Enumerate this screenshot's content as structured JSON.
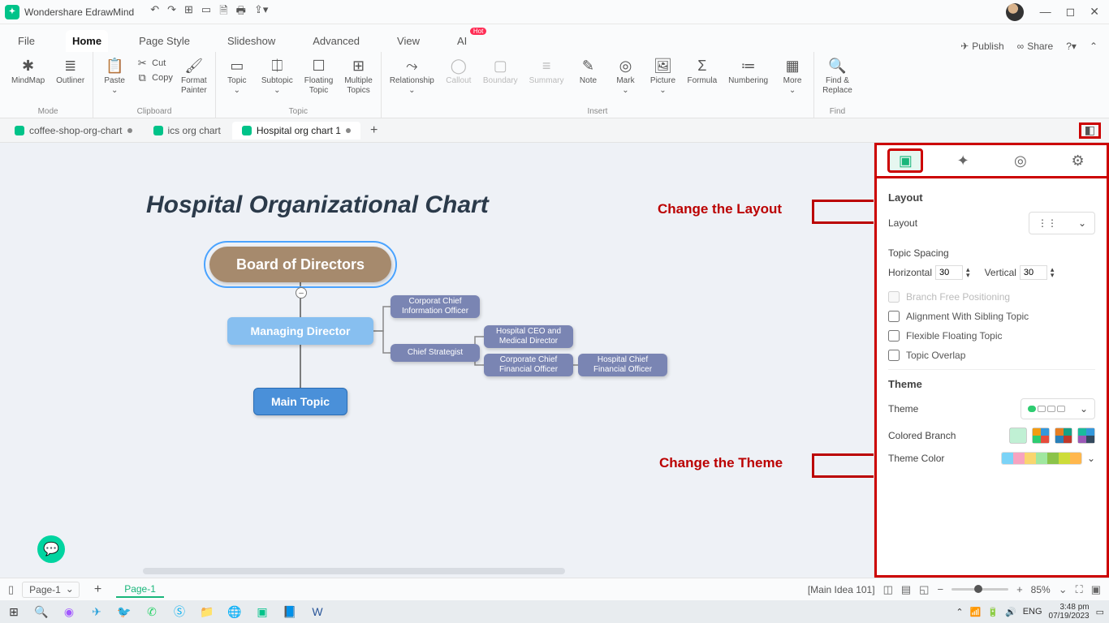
{
  "app": {
    "title": "Wondershare EdrawMind"
  },
  "menus": {
    "items": [
      "File",
      "Home",
      "Page Style",
      "Slideshow",
      "Advanced",
      "View",
      "AI"
    ],
    "active": "Home",
    "publish": "Publish",
    "share": "Share"
  },
  "ribbon": {
    "mode": {
      "label": "Mode",
      "mindmap": "MindMap",
      "outliner": "Outliner"
    },
    "clipboard": {
      "label": "Clipboard",
      "paste": "Paste",
      "cut": "Cut",
      "copy": "Copy",
      "format_painter": "Format\nPainter"
    },
    "topic": {
      "label": "Topic",
      "topic": "Topic",
      "subtopic": "Subtopic",
      "floating": "Floating\nTopic",
      "multiple": "Multiple\nTopics"
    },
    "insert": {
      "label": "Insert",
      "relationship": "Relationship",
      "callout": "Callout",
      "boundary": "Boundary",
      "summary": "Summary",
      "note": "Note",
      "mark": "Mark",
      "picture": "Picture",
      "formula": "Formula",
      "numbering": "Numbering",
      "more": "More"
    },
    "find": {
      "label": "Find",
      "find_replace": "Find &\nReplace"
    }
  },
  "tabs": {
    "items": [
      {
        "name": "coffee-shop-org-chart",
        "dirty": true
      },
      {
        "name": "ics org chart",
        "dirty": false
      },
      {
        "name": "Hospital org chart 1",
        "dirty": true
      }
    ],
    "active_index": 2
  },
  "chart": {
    "title": "Hospital Organizational Chart",
    "root": "Board of Directors",
    "managing": "Managing Director",
    "main_topic": "Main Topic",
    "sub1": "Corporat Chief Information Officer",
    "sub2": "Chief Strategist",
    "sub3": "Hospital CEO and Medical Director",
    "sub4": "Corporate Chief Financial Officer",
    "sub5": "Hospital Chief Financial Officer"
  },
  "annotations": {
    "layout": "Change the Layout",
    "theme": "Change the Theme"
  },
  "panel": {
    "layout_title": "Layout",
    "layout_label": "Layout",
    "topic_spacing": "Topic Spacing",
    "horizontal": "Horizontal",
    "vertical": "Vertical",
    "h_val": "30",
    "v_val": "30",
    "branch_free": "Branch Free Positioning",
    "align_sibling": "Alignment With Sibling Topic",
    "flex_float": "Flexible Floating Topic",
    "overlap": "Topic Overlap",
    "theme_title": "Theme",
    "theme_label": "Theme",
    "colored_branch": "Colored Branch",
    "theme_color": "Theme Color"
  },
  "status": {
    "page_sel": "Page-1",
    "page_tab": "Page-1",
    "main_idea": "[Main Idea 101]",
    "zoom": "85%"
  },
  "taskbar": {
    "lang": "ENG",
    "time": "3:48 pm",
    "date": "07/19/2023"
  }
}
